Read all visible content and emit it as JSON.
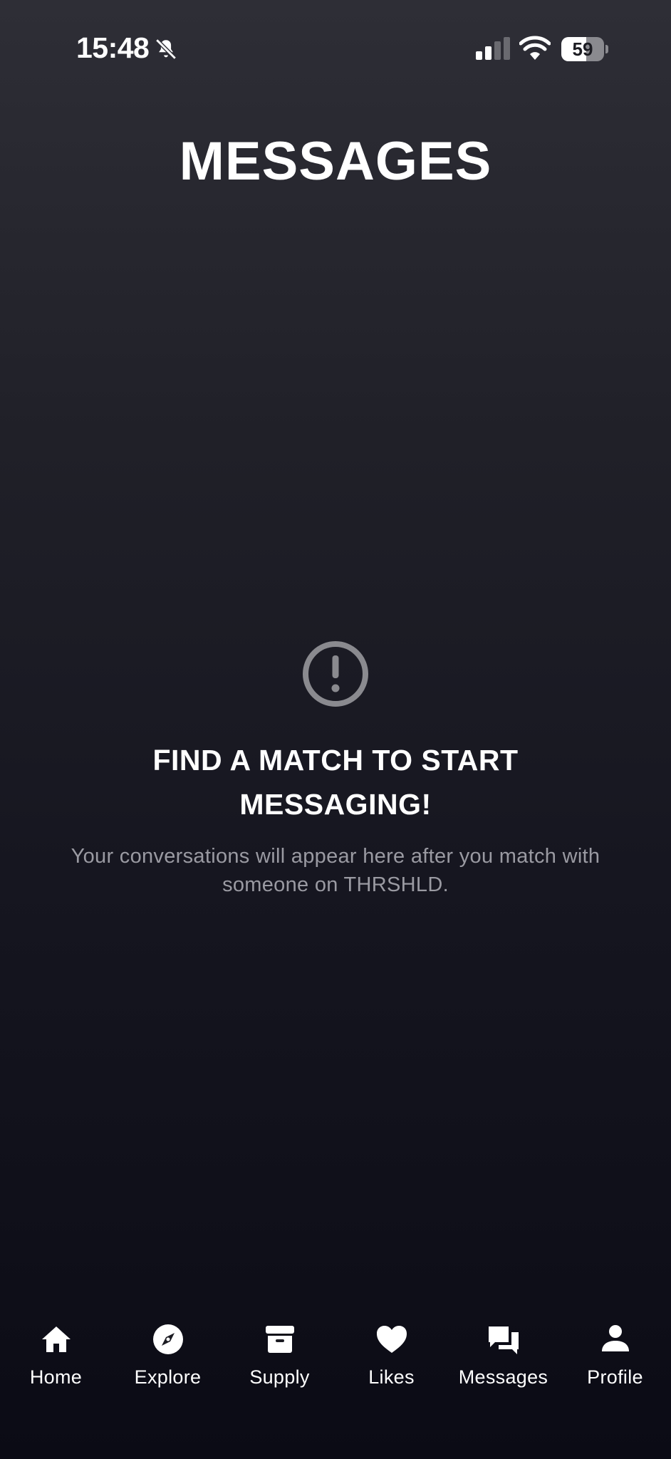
{
  "status_bar": {
    "time": "15:48",
    "battery_percent": "59",
    "battery_level": 0.59,
    "icons": [
      "bell-slash-icon",
      "cellular-signal-icon",
      "wifi-icon",
      "battery-icon"
    ]
  },
  "header": {
    "title": "MESSAGES"
  },
  "empty_state": {
    "icon": "exclamation-circle-icon",
    "heading": "FIND A MATCH TO START MESSAGING!",
    "body": "Your conversations will appear here after you match with someone on THRSHLD."
  },
  "tab_bar": {
    "active": "messages",
    "items": [
      {
        "label": "Home",
        "icon": "home-icon"
      },
      {
        "label": "Explore",
        "icon": "compass-icon"
      },
      {
        "label": "Supply",
        "icon": "archive-box-icon"
      },
      {
        "label": "Likes",
        "icon": "heart-icon"
      },
      {
        "label": "Messages",
        "icon": "chat-bubbles-icon"
      },
      {
        "label": "Profile",
        "icon": "person-icon"
      }
    ]
  },
  "colors": {
    "background_top": "#2e2e36",
    "background_bottom": "#0b0b15",
    "text_primary": "#ffffff",
    "text_secondary": "#9a9aa2",
    "icon_muted": "#8a8a8f"
  }
}
